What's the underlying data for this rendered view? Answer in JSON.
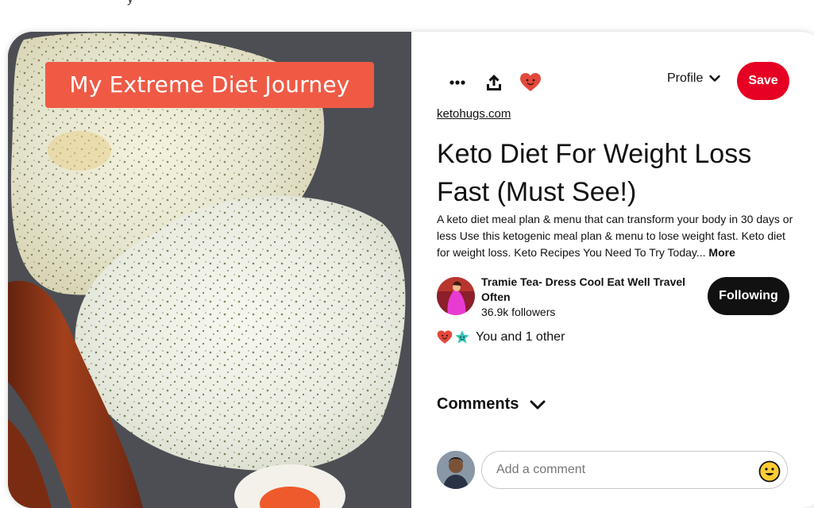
{
  "top_strip": {
    "fragment": "y"
  },
  "media": {
    "overlay_title": "My Extreme Diet Journey"
  },
  "actions": {
    "more_icon": "more-horizontal-icon",
    "share_icon": "share-upload-icon",
    "react_icon": "heart-face-icon",
    "profile_label": "Profile",
    "save_label": "Save"
  },
  "pin": {
    "source": "ketohugs.com",
    "title": "Keto Diet For Weight Loss Fast (Must See!)",
    "description": "A keto diet meal plan & menu that can transform your body in 30 days or less Use this ketogenic meal plan & menu to lose weight fast. Keto diet for weight loss. Keto Recipes You Need To Try Today...",
    "more_label": "More"
  },
  "creator": {
    "name": "Tramie Tea- Dress Cool Eat Well Travel Often",
    "followers": "36.9k followers",
    "follow_label": "Following"
  },
  "reactions": {
    "text": "You and 1 other"
  },
  "comments": {
    "heading": "Comments",
    "placeholder": "Add a comment"
  },
  "colors": {
    "save_red": "#e60023",
    "overlay_red": "#ef5a45",
    "follow_black": "#111111"
  }
}
